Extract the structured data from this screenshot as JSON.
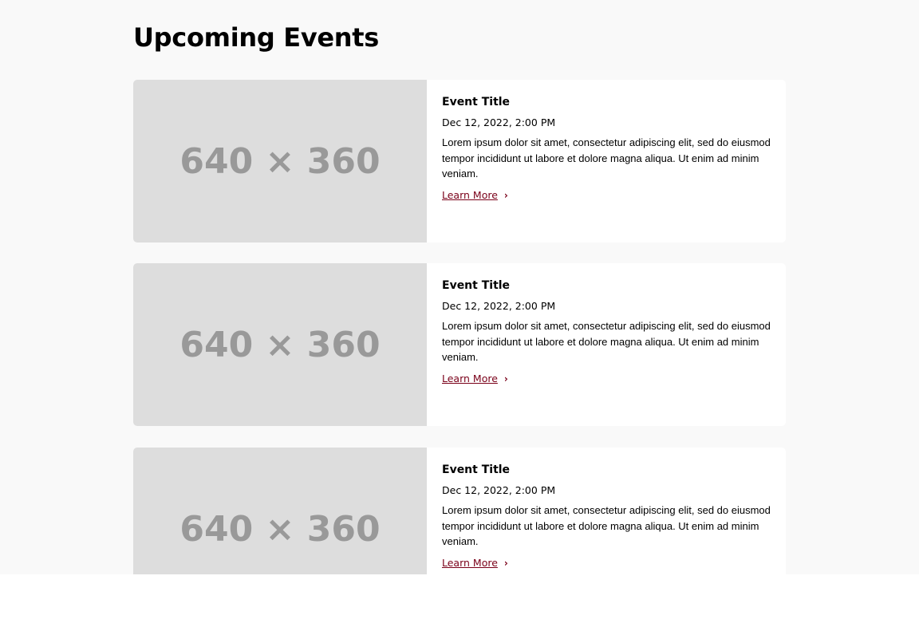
{
  "page_title": "Upcoming Events",
  "link_color": "#7a0019",
  "events": [
    {
      "image_label": "640 × 360",
      "title": "Event Title",
      "date": "Dec 12, 2022, 2:00 PM",
      "description": "Lorem ipsum dolor sit amet, consectetur adipiscing elit, sed do eiusmod tempor incididunt ut labore et dolore magna aliqua. Ut enim ad minim veniam.",
      "link": "Learn More"
    },
    {
      "image_label": "640 × 360",
      "title": "Event Title",
      "date": "Dec 12, 2022, 2:00 PM",
      "description": "Lorem ipsum dolor sit amet, consectetur adipiscing elit, sed do eiusmod tempor incididunt ut labore et dolore magna aliqua. Ut enim ad minim veniam.",
      "link": "Learn More"
    },
    {
      "image_label": "640 × 360",
      "title": "Event Title",
      "date": "Dec 12, 2022, 2:00 PM",
      "description": "Lorem ipsum dolor sit amet, consectetur adipiscing elit, sed do eiusmod tempor incididunt ut labore et dolore magna aliqua. Ut enim ad minim veniam.",
      "link": "Learn More"
    }
  ]
}
